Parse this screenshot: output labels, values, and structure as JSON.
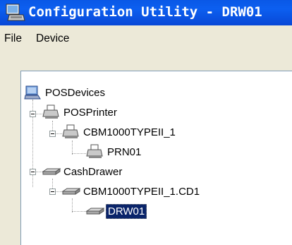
{
  "window": {
    "title": "Configuration Utility - DRW01",
    "accent_color": "#0a58e6"
  },
  "menu": {
    "items": [
      {
        "label": "File"
      },
      {
        "label": "Device"
      }
    ]
  },
  "tree": {
    "nodes": [
      {
        "label": "POSDevices",
        "icon": "pos-devices-icon",
        "expanded": true
      },
      {
        "label": "POSPrinter",
        "icon": "printer-icon",
        "expanded": true
      },
      {
        "label": "CBM1000TYPEII_1",
        "icon": "printer-icon",
        "expanded": true
      },
      {
        "label": "PRN01",
        "icon": "printer-icon"
      },
      {
        "label": "CashDrawer",
        "icon": "cash-drawer-icon",
        "expanded": true
      },
      {
        "label": "CBM1000TYPEII_1.CD1",
        "icon": "cash-drawer-icon",
        "expanded": true
      },
      {
        "label": "DRW01",
        "icon": "cash-drawer-icon",
        "selected": true
      }
    ]
  }
}
